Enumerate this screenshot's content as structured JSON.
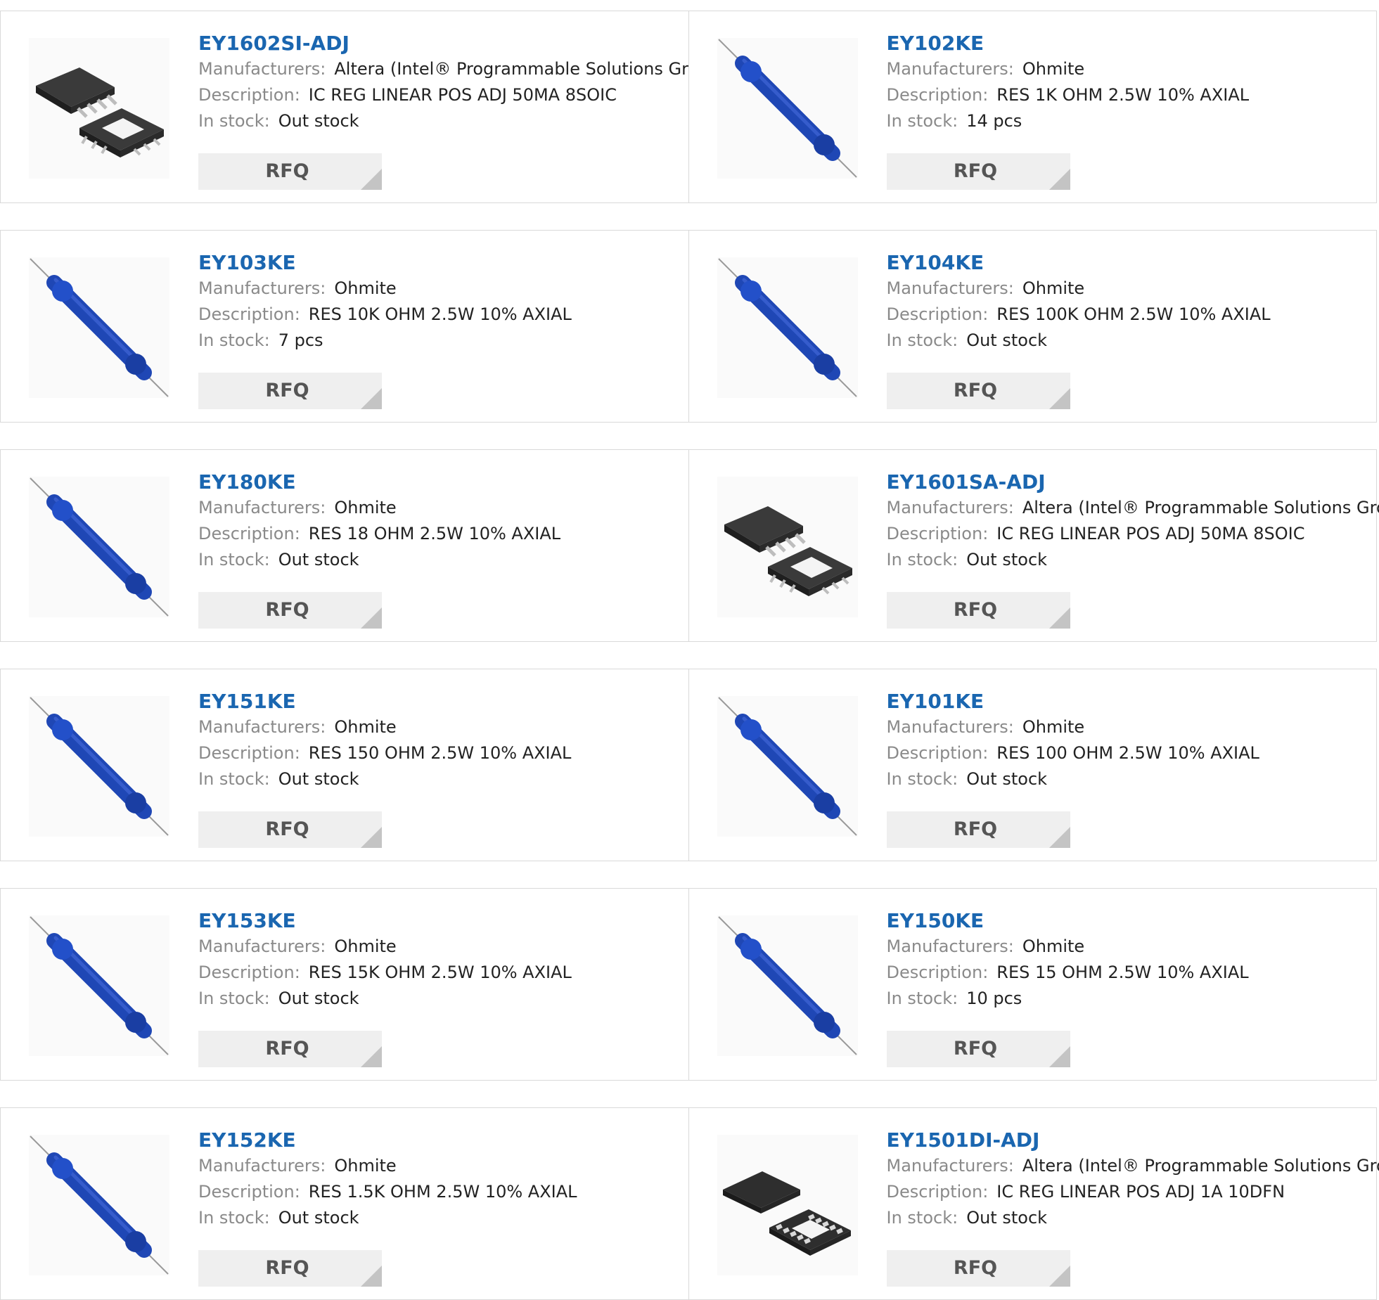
{
  "labels": {
    "manufacturers": "Manufacturers:",
    "description": "Description:",
    "in_stock": "In stock:",
    "rfq": "RFQ"
  },
  "colors": {
    "title": "#1a66b0",
    "resistor_body": "#1f47b5",
    "chip_body": "#2b2b2b"
  },
  "products": [
    {
      "part": "EY1602SI-ADJ",
      "manufacturer": "Altera (Intel® Programmable Solutions Group)",
      "description": "IC REG LINEAR POS ADJ 50MA 8SOIC",
      "stock": "Out stock",
      "image": "chip-8soic"
    },
    {
      "part": "EY102KE",
      "manufacturer": "Ohmite",
      "description": "RES 1K OHM 2.5W 10% AXIAL",
      "stock": "14 pcs",
      "image": "resistor"
    },
    {
      "part": "EY103KE",
      "manufacturer": "Ohmite",
      "description": "RES 10K OHM 2.5W 10% AXIAL",
      "stock": "7 pcs",
      "image": "resistor"
    },
    {
      "part": "EY104KE",
      "manufacturer": "Ohmite",
      "description": "RES 100K OHM 2.5W 10% AXIAL",
      "stock": "Out stock",
      "image": "resistor"
    },
    {
      "part": "EY180KE",
      "manufacturer": "Ohmite",
      "description": "RES 18 OHM 2.5W 10% AXIAL",
      "stock": "Out stock",
      "image": "resistor"
    },
    {
      "part": "EY1601SA-ADJ",
      "manufacturer": "Altera (Intel® Programmable Solutions Group)",
      "description": "IC REG LINEAR POS ADJ 50MA 8SOIC",
      "stock": "Out stock",
      "image": "chip-8soic"
    },
    {
      "part": "EY151KE",
      "manufacturer": "Ohmite",
      "description": "RES 150 OHM 2.5W 10% AXIAL",
      "stock": "Out stock",
      "image": "resistor"
    },
    {
      "part": "EY101KE",
      "manufacturer": "Ohmite",
      "description": "RES 100 OHM 2.5W 10% AXIAL",
      "stock": "Out stock",
      "image": "resistor"
    },
    {
      "part": "EY153KE",
      "manufacturer": "Ohmite",
      "description": "RES 15K OHM 2.5W 10% AXIAL",
      "stock": "Out stock",
      "image": "resistor"
    },
    {
      "part": "EY150KE",
      "manufacturer": "Ohmite",
      "description": "RES 15 OHM 2.5W 10% AXIAL",
      "stock": "10 pcs",
      "image": "resistor"
    },
    {
      "part": "EY152KE",
      "manufacturer": "Ohmite",
      "description": "RES 1.5K OHM 2.5W 10% AXIAL",
      "stock": "Out stock",
      "image": "resistor"
    },
    {
      "part": "EY1501DI-ADJ",
      "manufacturer": "Altera (Intel® Programmable Solutions Group)",
      "description": "IC REG LINEAR POS ADJ 1A 10DFN",
      "stock": "Out stock",
      "image": "chip-10dfn"
    }
  ]
}
